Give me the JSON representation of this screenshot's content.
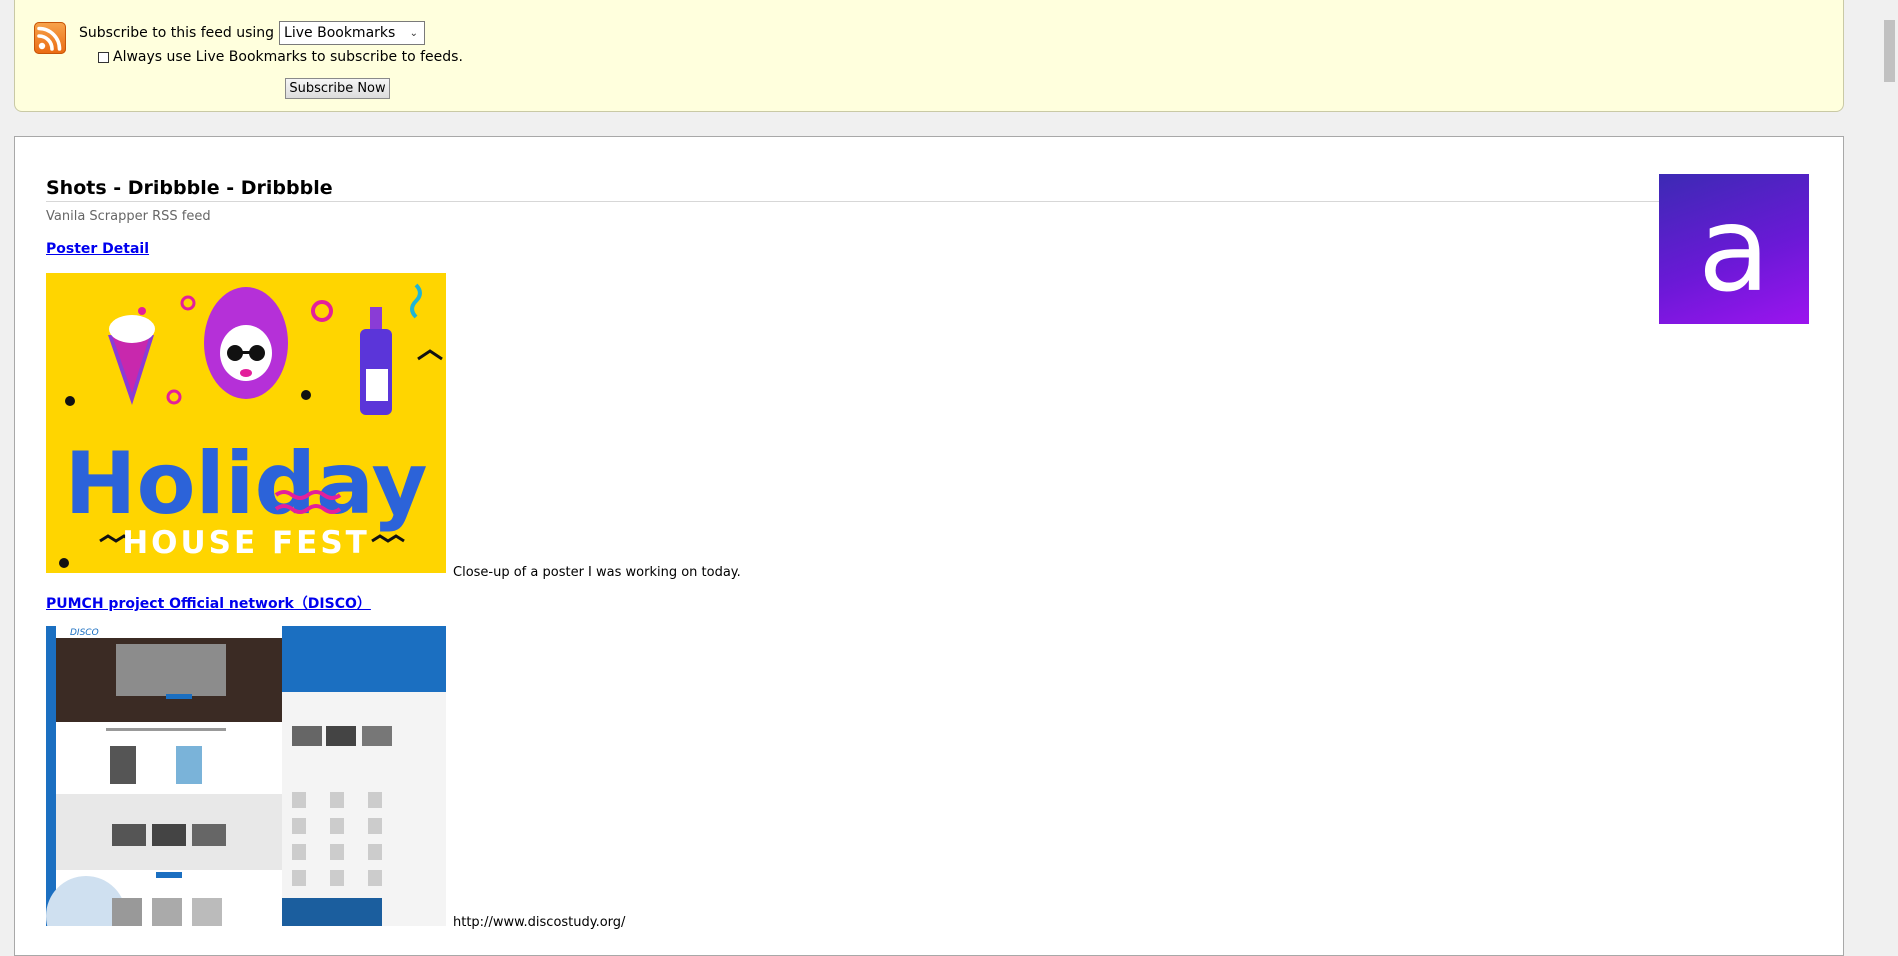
{
  "subscribe": {
    "label": "Subscribe to this feed using",
    "reader_selected": "Live Bookmarks",
    "always_label": "Always use Live Bookmarks to subscribe to feeds.",
    "button_label": "Subscribe Now"
  },
  "feed": {
    "title": "Shots - Dribbble - Dribbble",
    "subtitle": "Vanila Scrapper RSS feed",
    "logo_letter": "a",
    "entries": [
      {
        "title": "Poster Detail",
        "description": "Close-up of a poster I was working on today.",
        "image_text_main": "Holiday",
        "image_text_sub": "HOUSE FEST"
      },
      {
        "title": "PUMCH project Official network（DISCO）",
        "description": "http://www.discostudy.org/",
        "image_brand": "DISCO"
      }
    ]
  },
  "colors": {
    "header_bg": "#ffffdd",
    "link": "#0000ee",
    "logo_gradient_start": "#3c2ab4",
    "logo_gradient_end": "#9c14ef",
    "poster_bg": "#ffd500"
  },
  "icons": [
    "rss-feed-icon",
    "chevron-down-icon"
  ]
}
